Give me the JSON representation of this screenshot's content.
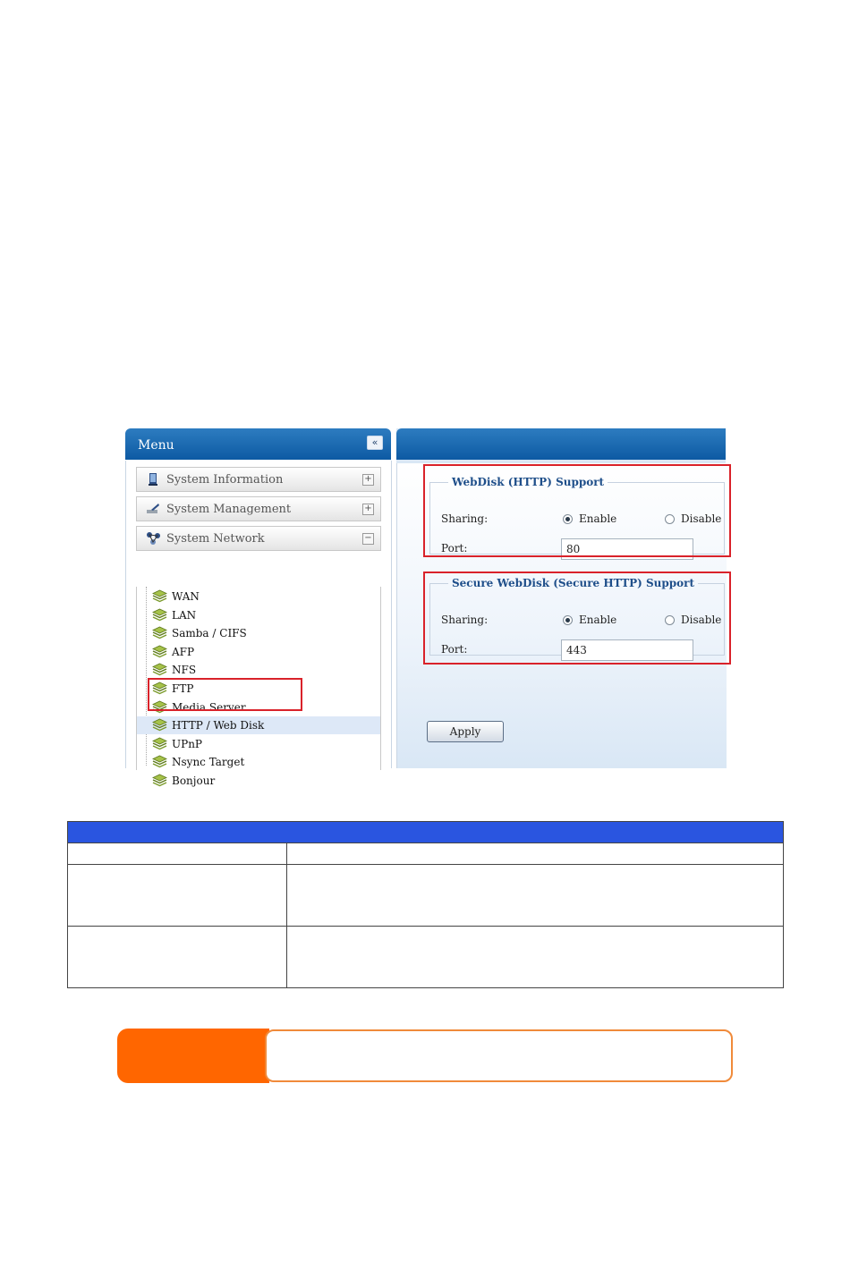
{
  "menu": {
    "title": "Menu",
    "collapse_icon": "«",
    "categories": [
      {
        "label": "System Information",
        "toggle": "+",
        "icon": "info-icon"
      },
      {
        "label": "System Management",
        "toggle": "+",
        "icon": "management-icon"
      },
      {
        "label": "System Network",
        "toggle": "−",
        "icon": "network-icon"
      }
    ],
    "network_items": [
      {
        "label": "WAN"
      },
      {
        "label": "LAN"
      },
      {
        "label": "Samba / CIFS"
      },
      {
        "label": "AFP"
      },
      {
        "label": "NFS"
      },
      {
        "label": "FTP"
      },
      {
        "label": "Media Server"
      },
      {
        "label": "HTTP / Web Disk",
        "selected": true
      },
      {
        "label": "UPnP"
      },
      {
        "label": "Nsync Target"
      },
      {
        "label": "Bonjour"
      }
    ]
  },
  "webdisk": {
    "legend": "WebDisk (HTTP) Support",
    "sharing_label": "Sharing:",
    "enable_label": "Enable",
    "disable_label": "Disable",
    "selected": "Enable",
    "port_label": "Port:",
    "port_value": "80"
  },
  "secure_webdisk": {
    "legend": "Secure WebDisk (Secure HTTP) Support",
    "sharing_label": "Sharing:",
    "enable_label": "Enable",
    "disable_label": "Disable",
    "selected": "Enable",
    "port_label": "Port:",
    "port_value": "443"
  },
  "apply_label": "Apply",
  "colors": {
    "header_blue": "#1565b0",
    "highlight_red": "#d9222a",
    "table_header": "#2a55e0",
    "note_orange": "#ff6600"
  }
}
